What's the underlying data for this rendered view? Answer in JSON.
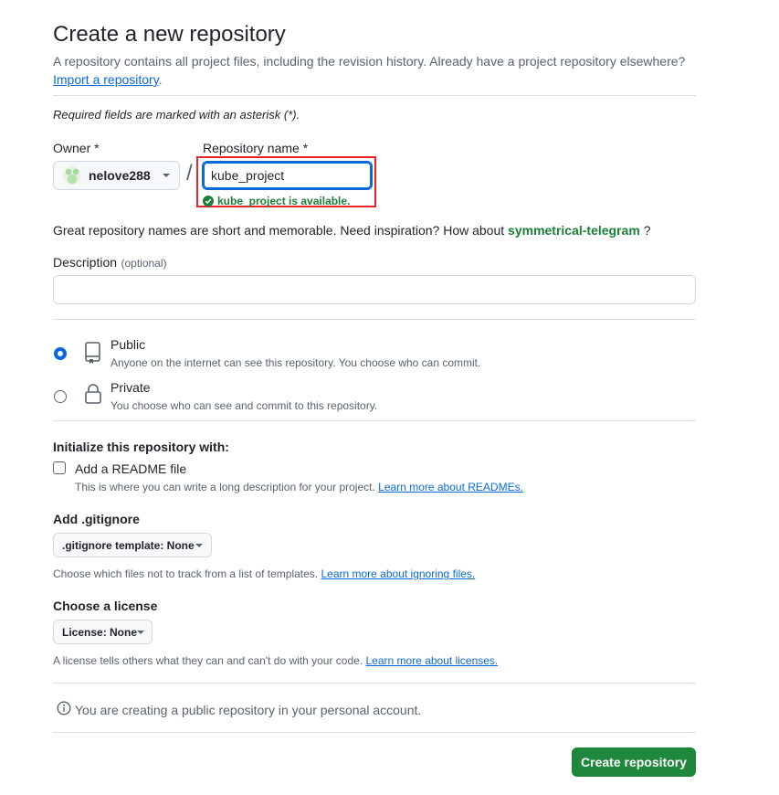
{
  "header": {
    "title": "Create a new repository",
    "description": "A repository contains all project files, including the revision history. Already have a project repository elsewhere?",
    "import_link": "Import a repository",
    "import_suffix": "."
  },
  "required_note": "Required fields are marked with an asterisk (*).",
  "owner": {
    "label": "Owner *",
    "value": "nelove288"
  },
  "separator": "/",
  "repo_name": {
    "label": "Repository name *",
    "value": "kube_project",
    "availability": "kube_project is available."
  },
  "suggestion": {
    "prefix": "Great repository names are short and memorable. Need inspiration? How about",
    "name": "symmetrical-telegram",
    "suffix": "?"
  },
  "description_field": {
    "label": "Description",
    "optional": "(optional)",
    "value": ""
  },
  "visibility": {
    "selected": "public",
    "public": {
      "title": "Public",
      "desc": "Anyone on the internet can see this repository. You choose who can commit."
    },
    "private": {
      "title": "Private",
      "desc": "You choose who can see and commit to this repository."
    }
  },
  "init": {
    "heading": "Initialize this repository with:",
    "readme_label": "Add a README file",
    "readme_checked": false,
    "readme_desc": "This is where you can write a long description for your project.",
    "readme_link": "Learn more about READMEs."
  },
  "gitignore": {
    "heading": "Add .gitignore",
    "button": ".gitignore template: None",
    "desc": "Choose which files not to track from a list of templates.",
    "link": "Learn more about ignoring files."
  },
  "license": {
    "heading": "Choose a license",
    "button": "License: None",
    "desc": "A license tells others what they can and can't do with your code.",
    "link": "Learn more about licenses."
  },
  "notice": "You are creating a public repository in your personal account.",
  "submit_label": "Create repository",
  "colors": {
    "primary": "#1f883d",
    "accent_blue": "#0969da",
    "success": "#1a7f37",
    "highlight": "#e5252a"
  }
}
